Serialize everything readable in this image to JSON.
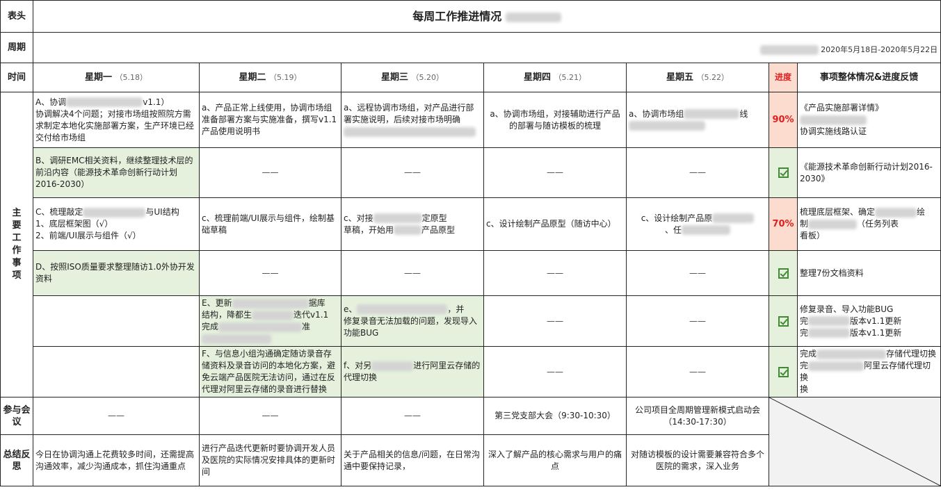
{
  "sheet": {
    "side_header": "表头",
    "side_period": "周期",
    "side_time": "时间",
    "side_main": "主要工作事项",
    "side_meeting": "参与会议",
    "side_summary": "总结反思",
    "title": "每周工作推进情况",
    "period": "2020年5月18日-2020年5月22日",
    "progress_head": "进度",
    "feedback_head": "事项整体情况&进度反馈",
    "dash": "——"
  },
  "days": [
    {
      "name": "星期一",
      "date": "（5.18）"
    },
    {
      "name": "星期二",
      "date": "（5.19）"
    },
    {
      "name": "星期三",
      "date": "（5.20）"
    },
    {
      "name": "星期四",
      "date": "（5.21）"
    },
    {
      "name": "星期五",
      "date": "（5.22）"
    }
  ],
  "rows": [
    {
      "mon_a": "A、协调",
      "mon_b": "v1.1）",
      "mon_c": "协调解决4个问题；对接市场组按照院方需求制定本地化实施部署方案，生产环境已经交付给市场组",
      "tue": "a、产品正常上线使用，协调市场组准备部署方案与实施准备，撰写v1.1产品使用说明书",
      "wed": "a、远程协调市场组，对产品进行部署实施说明，后续对接市场明确",
      "thu": "a、协调市场组，对接辅助进行产品的部署与随访模板的梳理",
      "fri_a": "a、协调市场组",
      "fri_b": "线",
      "progress": "90%",
      "fb_a": "《产品实施部署详情》",
      "fb_b": "协调实施线路认证"
    },
    {
      "mon": "B、调研EMC相关资料，继续整理技术层的前沿内容（能源技术革命创新行动计划2016-2030）",
      "fb": "《能源技术革命创新行动计划2016-2030》"
    },
    {
      "mon_a": "C、梳理敲定",
      "mon_b": "与UI结构",
      "mon_c": "1、底层框架图（√）",
      "mon_d": "2、前端/UI展示与组件（√）",
      "tue": "c、梳理前端/UI展示与组件，绘制基础草稿",
      "wed_a": "c、对接",
      "wed_b": "定原型",
      "wed_c": "草稿，开始用",
      "wed_d": "产品原型",
      "thu": "c、设计绘制产品原型（随访中心）",
      "fri_a": "c、设计绘制产品原",
      "fri_b": "、任",
      "progress": "70%",
      "fb_a": "梳理底层框架、确定",
      "fb_b": "绘",
      "fb_c": "制",
      "fb_d": "（任务列表",
      "fb_e": "看板）"
    },
    {
      "mon": "D、按照ISO质量要求整理随访1.0外协开发资料",
      "fb": "整理7份文档资料"
    },
    {
      "tue_a": "E、更新",
      "tue_b": "据库",
      "tue_c": "结构，降都生",
      "tue_d": "迭代v1.1",
      "tue_e": "完成",
      "tue_f": "准",
      "wed_a": "e、",
      "wed_b": "，并",
      "wed_c": "修复录音无法加载的问题，发现导入功能BUG",
      "fb_a": "修复录音、导入功能BUG",
      "fb_b": "完",
      "fb_c": "版本v1.1更新",
      "fb_d": "完",
      "fb_e": "版本v1.1更新"
    },
    {
      "tue": "F、与信息小组沟通确定随访录音存储资料及录音访问的本地化方案，避免云端产品医院无法访问，通过在反代理对阿里云存储的录音进行替换",
      "wed_a": "f、对另",
      "wed_b": "进行阿里云存储的代理切换",
      "fb_a": "完成",
      "fb_b": "存储代理切换",
      "fb_c": "完",
      "fb_d": "阿里云存储代理切换",
      "fb_e": "换"
    }
  ],
  "meetings": {
    "thu": "第三党支部大会（9:30-10:30）",
    "fri": "公司项目全周期管理新模式启动会（14:30-17:30）"
  },
  "summary": {
    "mon": "今日在协调沟通上花费较多时间，还需提高沟通效率，减少沟通成本，抓住沟通重点",
    "tue": "进行产品迭代更新时要协调开发人员及医院的实际情况安排具体的更新时间",
    "wed": "关于产品相关的信息/问题，在日常沟通中要保持记录，",
    "thu": "深入了解产品的核心需求与用户的痛点",
    "fri": "对随访模板的设计需要兼容符合多个医院的需求，深入业务"
  },
  "colors": {
    "green": "#e5f1dd",
    "progress_bg": "#fbdccf",
    "progress_text": "#e02020",
    "check": "#3f8a32"
  }
}
